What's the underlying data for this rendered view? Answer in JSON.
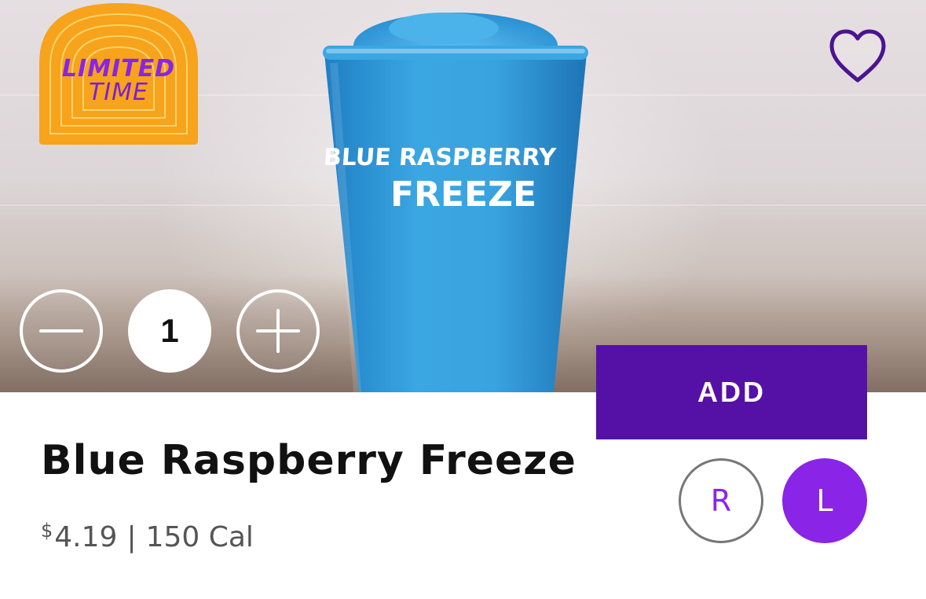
{
  "product": {
    "name": "Blue Raspberry Freeze",
    "price_currency": "$",
    "price_value": "4.19",
    "separator": "|",
    "calories": "150 Cal"
  },
  "badge": {
    "line1": "LIMITED",
    "line2": "TIME"
  },
  "cup_label": {
    "line1": "BLUE RASPBERRY",
    "line2": "FREEZE"
  },
  "quantity": {
    "value": "1"
  },
  "actions": {
    "add_label": "ADD"
  },
  "sizes": [
    {
      "label": "R",
      "selected": false
    },
    {
      "label": "L",
      "selected": true
    }
  ],
  "icons": {
    "favorite": "heart-outline-icon",
    "decrease": "minus-icon",
    "increase": "plus-icon"
  },
  "colors": {
    "brand_purple": "#5511a6",
    "accent_purple": "#8a24e6",
    "badge_orange": "#f7a31c",
    "drink_blue": "#2f9ad8"
  }
}
